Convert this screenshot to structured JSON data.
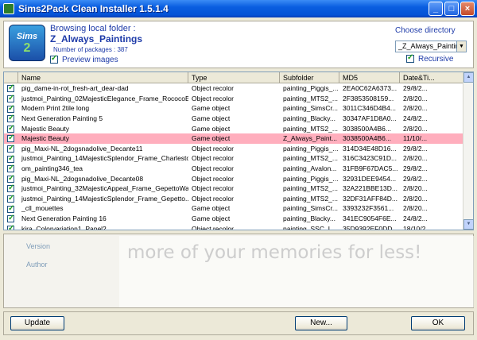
{
  "window": {
    "title": "Sims2Pack Clean Installer 1.5.1.4",
    "minimize": "_",
    "maximize": "□",
    "close": "×"
  },
  "header": {
    "logo_text": "Sims",
    "logo_sub": "2",
    "browsing_label": "Browsing local folder :",
    "folder_name": "Z_Always_Paintings",
    "package_count": "Number of packages : 387",
    "preview_label": "Preview images",
    "choose_directory_label": "Choose directory",
    "directory_value": "_Z_Always_Painting",
    "recursive_label": "Recursive"
  },
  "grid": {
    "columns": [
      "Name",
      "Type",
      "Subfolder",
      "MD5",
      "Date&Ti..."
    ],
    "rows": [
      {
        "name": "pig_dame-in-rot_fresh-art_dear-dad",
        "type": "Object recolor",
        "subfolder": "painting_Piggis_...",
        "md5": "2EA0C62A6373...",
        "date": "29/8/2..."
      },
      {
        "name": "justmoi_Painting_02MajesticElegance_Frame_RococoB...",
        "type": "Object recolor",
        "subfolder": "painting_MTS2_...",
        "md5": "2F3853508159...",
        "date": "2/8/20..."
      },
      {
        "name": "Modern Print 2tile long",
        "type": "Game object",
        "subfolder": "painting_SimsCr...",
        "md5": "3011C346D4B4...",
        "date": "2/8/20..."
      },
      {
        "name": "Next Generation Painting 5",
        "type": "Game object",
        "subfolder": "painting_Blacky...",
        "md5": "30347AF1D8A0...",
        "date": "24/8/2..."
      },
      {
        "name": "Majestic Beauty",
        "type": "Game object",
        "subfolder": "painting_MTS2_...",
        "md5": "3038500A4B6...",
        "date": "2/8/20..."
      },
      {
        "name": "Majestic Beauty",
        "type": "Game object",
        "subfolder": "Z_Always_Paint...",
        "md5": "3038500A4B6...",
        "date": "11/10/..."
      },
      {
        "name": "pig_Maxi-NL_2dogsnadolive_Decante11",
        "type": "Object recolor",
        "subfolder": "painting_Piggis_...",
        "md5": "314D34E48D16...",
        "date": "29/8/2..."
      },
      {
        "name": "justmoi_Painting_14MajesticSplendor_Frame_Charlesto...",
        "type": "Object recolor",
        "subfolder": "painting_MTS2_...",
        "md5": "316C3423C91D...",
        "date": "2/8/20..."
      },
      {
        "name": "om_painting346_tea",
        "type": "Object recolor",
        "subfolder": "painting_Avalon...",
        "md5": "31FB9F67DAC5...",
        "date": "29/8/2..."
      },
      {
        "name": "pig_Maxi-NL_2dogsnadolive_Decante08",
        "type": "Object recolor",
        "subfolder": "painting_Piggis_...",
        "md5": "32931DEE9454...",
        "date": "29/8/2..."
      },
      {
        "name": "justmoi_Painting_32MajesticAppeal_Frame_GepettoWal...",
        "type": "Object recolor",
        "subfolder": "painting_MTS2_...",
        "md5": "32A221BBE13D...",
        "date": "2/8/20..."
      },
      {
        "name": "justmoi_Painting_14MajesticSplendor_Frame_Gepetto...",
        "type": "Object recolor",
        "subfolder": "painting_MTS2_...",
        "md5": "32DF31AFF84D...",
        "date": "2/8/20..."
      },
      {
        "name": "_cll_mouettes",
        "type": "Game object",
        "subfolder": "painting_SimsCr...",
        "md5": "3393232F3561...",
        "date": "2/8/20..."
      },
      {
        "name": "Next Generation Painting 16",
        "type": "Game object",
        "subfolder": "painting_Blacky...",
        "md5": "341EC9054F6E...",
        "date": "24/8/2..."
      },
      {
        "name": "kira_Colorvariation1_Panel2",
        "type": "Object recolor",
        "subfolder": "painting_SSC_L...",
        "md5": "35D9392EF0DD...",
        "date": "18/10/2..."
      }
    ]
  },
  "details": {
    "version_label": "Version",
    "author_label": "Author"
  },
  "watermark": {
    "text": "more of your memories for less!"
  },
  "footer": {
    "update_label": "Update",
    "new_label": "New...",
    "ok_label": "OK"
  },
  "colors": {
    "title_bar": "#0a5ee0",
    "selected_row": "#ffaebd",
    "accent_text": "#1d3aa8"
  }
}
